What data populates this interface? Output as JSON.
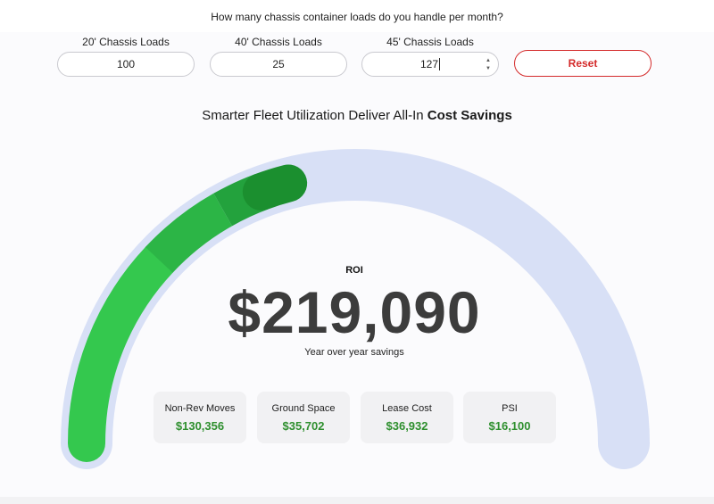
{
  "question": "How many chassis container loads do you handle per month?",
  "inputs": [
    {
      "label": "20' Chassis Loads",
      "value": "100"
    },
    {
      "label": "40' Chassis Loads",
      "value": "25"
    },
    {
      "label": "45' Chassis Loads",
      "value": "127"
    }
  ],
  "reset_label": "Reset",
  "headline": {
    "prefix": "Smarter Fleet Utilization Deliver All-In ",
    "emphasis": "Cost Savings"
  },
  "roi": {
    "label": "ROI",
    "value": "$219,090",
    "subtitle": "Year over year savings"
  },
  "cards": [
    {
      "title": "Non-Rev Moves",
      "value": "$130,356"
    },
    {
      "title": "Ground Space",
      "value": "$35,702"
    },
    {
      "title": "Lease Cost",
      "value": "$36,932"
    },
    {
      "title": "PSI",
      "value": "$16,100"
    }
  ],
  "gauge": {
    "fill_fraction": 0.42,
    "track_color": "#d8e0f6",
    "segment_colors": [
      "#34c84e",
      "#2cb546",
      "#23a23d",
      "#1b8f2f"
    ]
  },
  "colors": {
    "accent_red": "#d42a2a",
    "value_green": "#2e8f2e"
  }
}
